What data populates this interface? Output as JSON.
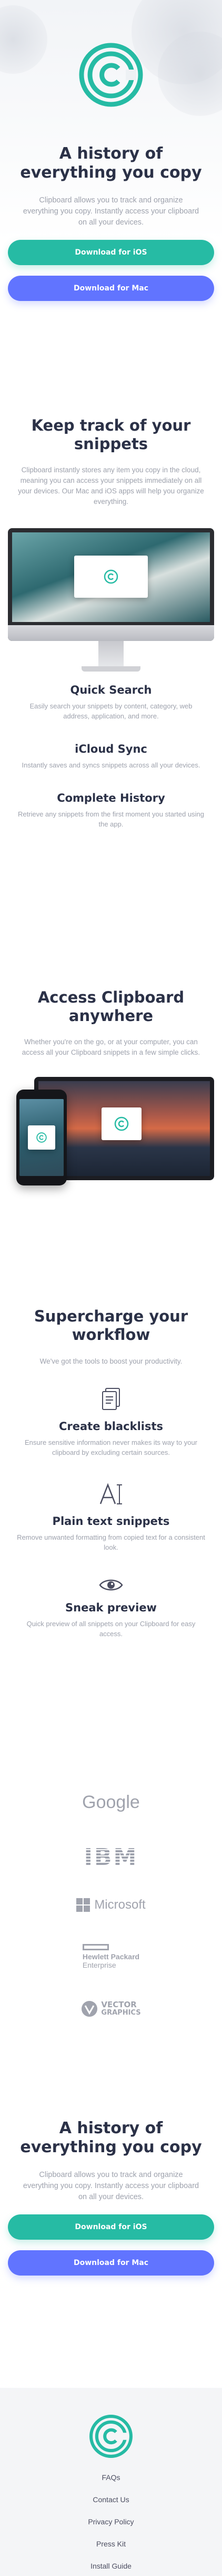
{
  "hero": {
    "title": "A history of everything you copy",
    "description": "Clipboard allows you to track and organize everything you copy. Instantly access your clipboard on all your devices.",
    "ios_button": "Download for iOS",
    "mac_button": "Download for Mac"
  },
  "snippets": {
    "title": "Keep track of your snippets",
    "description": "Clipboard instantly stores any item you copy in the cloud, meaning you can access your snippets immediately on all your devices. Our Mac and iOS apps will help you organize everything.",
    "features": [
      {
        "title": "Quick Search",
        "text": "Easily search your snippets by content, category, web address, application, and more."
      },
      {
        "title": "iCloud Sync",
        "text": "Instantly saves and syncs snippets across all your devices."
      },
      {
        "title": "Complete History",
        "text": "Retrieve any snippets from the first moment you started using the app."
      }
    ]
  },
  "access": {
    "title": "Access Clipboard anywhere",
    "description": "Whether you're on the go, or at your computer, you can access all your Clipboard snippets in a few simple clicks."
  },
  "workflow": {
    "title": "Supercharge your workflow",
    "description": "We've got the tools to boost your productivity.",
    "tools": [
      {
        "title": "Create blacklists",
        "text": "Ensure sensitive information never makes its way to your clipboard by excluding certain sources.",
        "icon": "blacklist-icon"
      },
      {
        "title": "Plain text snippets",
        "text": "Remove unwanted formatting from copied text for a consistent look.",
        "icon": "text-icon"
      },
      {
        "title": "Sneak preview",
        "text": "Quick preview of all snippets on your Clipboard for easy access.",
        "icon": "eye-icon"
      }
    ]
  },
  "brands": {
    "google": "Google",
    "ibm": "IBM",
    "microsoft": "Microsoft",
    "hp_line1": "Hewlett Packard",
    "hp_line2": "Enterprise",
    "vector_line1": "VECTOR",
    "vector_line2": "GRAPHICS"
  },
  "cta": {
    "title": "A history of everything you copy",
    "description": "Clipboard allows you to track and organize everything you copy. Instantly access your clipboard on all your devices.",
    "ios_button": "Download for iOS",
    "mac_button": "Download for Mac"
  },
  "footer": {
    "links": [
      "FAQs",
      "Contact Us",
      "Privacy Policy",
      "Press Kit",
      "Install Guide"
    ],
    "socials": [
      "facebook-icon",
      "twitter-icon",
      "instagram-icon"
    ]
  },
  "colors": {
    "accent_green": "#26bba4",
    "accent_blue": "#6174ff",
    "heading": "#2b3147",
    "muted_text": "#9ea2ad"
  }
}
